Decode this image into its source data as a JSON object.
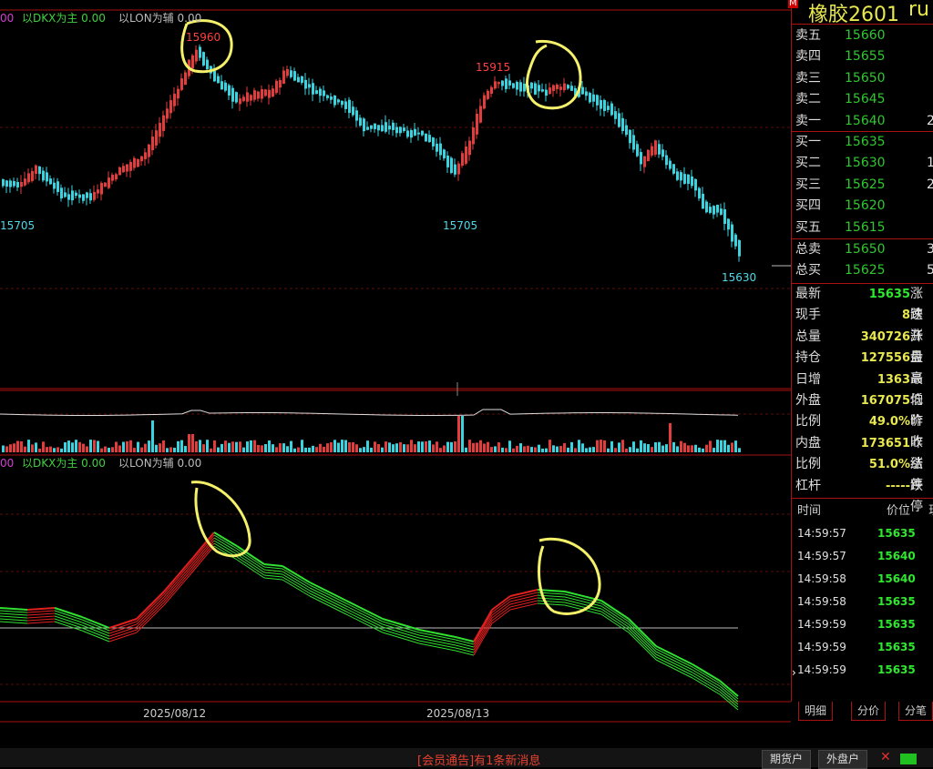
{
  "chart": {
    "legend_top": {
      "prefix": "00",
      "main": "以DKX为主 0.00",
      "aux": "以LON为辅 0.00"
    },
    "legend_bottom": {
      "prefix": "00",
      "main": "以DKX为主 0.00",
      "aux": "以LON为辅 0.00"
    },
    "price_labels": {
      "high_left": "15960",
      "high_right": "15915",
      "low_left": "15705",
      "low_mid": "15705",
      "low_right": "15630"
    },
    "dates": [
      "2025/08/12",
      "2025/08/13"
    ],
    "colors": {
      "up": "#e23c3c",
      "down": "#3cd3e0",
      "grid": "#7a1010",
      "dkx_up": "#e02020",
      "dkx_down": "#30e030",
      "annotation": "#f4f06a"
    }
  },
  "panel": {
    "title": "橡胶2601",
    "code": "ru",
    "marker": "M",
    "asks": [
      {
        "label": "卖五",
        "price": "15660",
        "vol": ""
      },
      {
        "label": "卖四",
        "price": "15655",
        "vol": ""
      },
      {
        "label": "卖三",
        "price": "15650",
        "vol": ""
      },
      {
        "label": "卖二",
        "price": "15645",
        "vol": ""
      },
      {
        "label": "卖一",
        "price": "15640",
        "vol": "2"
      }
    ],
    "bids": [
      {
        "label": "买一",
        "price": "15635",
        "vol": ""
      },
      {
        "label": "买二",
        "price": "15630",
        "vol": "1"
      },
      {
        "label": "买三",
        "price": "15625",
        "vol": "2"
      },
      {
        "label": "买四",
        "price": "15620",
        "vol": ""
      },
      {
        "label": "买五",
        "price": "15615",
        "vol": ""
      }
    ],
    "totals": [
      {
        "label": "总卖",
        "price": "15650",
        "vol": "3"
      },
      {
        "label": "总买",
        "price": "15625",
        "vol": "5"
      }
    ],
    "stats": [
      {
        "label": "最新",
        "value": "15635",
        "color": "#2ee82e",
        "label2": "涨跌"
      },
      {
        "label": "现手",
        "value": "8",
        "color": "#e8e84e",
        "label2": "速涨"
      },
      {
        "label": "总量",
        "value": "340726",
        "color": "#e8e84e",
        "label2": "开盘"
      },
      {
        "label": "持仓",
        "value": "127556",
        "color": "#e8e84e",
        "label2": "最高"
      },
      {
        "label": "日增",
        "value": "1363",
        "color": "#e8e84e",
        "label2": "最低"
      },
      {
        "label": "外盘",
        "value": "167075",
        "color": "#e8e84e",
        "label2": "均价"
      },
      {
        "label": "比例",
        "value": "49.0%",
        "color": "#e8e84e",
        "label2": "昨收"
      },
      {
        "label": "内盘",
        "value": "173651",
        "color": "#e8e84e",
        "label2": "昨结"
      },
      {
        "label": "比例",
        "value": "51.0%",
        "color": "#e8e84e",
        "label2": "涨停"
      },
      {
        "label": "杠杆",
        "value": "-----",
        "color": "#e8e84e",
        "label2": "跌停"
      }
    ],
    "ticks_header": {
      "time": "时间",
      "price": "价位",
      "extra": "现"
    },
    "ticks": [
      {
        "time": "14:59:57",
        "price": "15635"
      },
      {
        "time": "14:59:57",
        "price": "15640"
      },
      {
        "time": "14:59:58",
        "price": "15640"
      },
      {
        "time": "14:59:58",
        "price": "15635"
      },
      {
        "time": "14:59:59",
        "price": "15635"
      },
      {
        "time": "14:59:59",
        "price": "15635"
      },
      {
        "time": "14:59:59",
        "price": "15635"
      }
    ],
    "tabs": [
      "明细",
      "分价",
      "分笔"
    ]
  },
  "status": {
    "notice": "[会员通告]有1条新消息",
    "btn_futures": "期货户",
    "btn_foreign": "外盘户"
  }
}
